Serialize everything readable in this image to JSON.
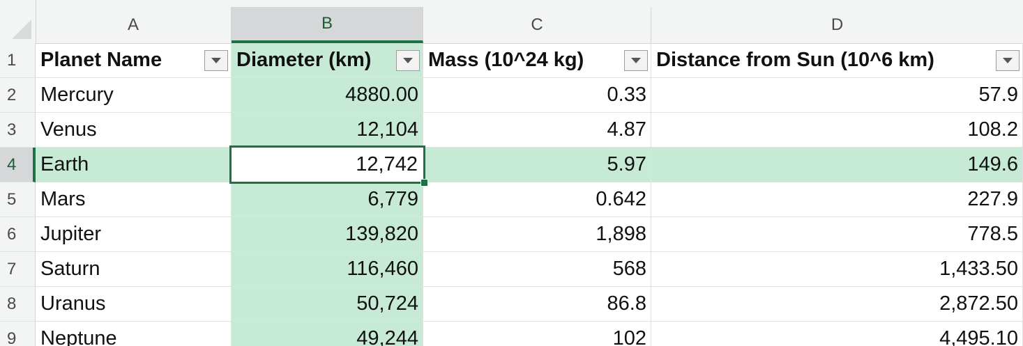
{
  "columns": [
    {
      "letter": "A"
    },
    {
      "letter": "B",
      "selected": true
    },
    {
      "letter": "C"
    },
    {
      "letter": "D"
    }
  ],
  "rows": [
    "1",
    "2",
    "3",
    "4",
    "5",
    "6",
    "7",
    "8",
    "9"
  ],
  "headers": {
    "planet": "Planet Name",
    "diameter": "Diameter (km)",
    "mass": "Mass (10^24 kg)",
    "distance": "Distance from Sun (10^6 km)"
  },
  "planets": [
    {
      "name": "Mercury",
      "diameter": "4880.00",
      "mass": "0.33",
      "distance": "57.9"
    },
    {
      "name": "Venus",
      "diameter": "12,104",
      "mass": "4.87",
      "distance": "108.2"
    },
    {
      "name": "Earth",
      "diameter": "12,742",
      "mass": "5.97",
      "distance": "149.6"
    },
    {
      "name": "Mars",
      "diameter": "6,779",
      "mass": "0.642",
      "distance": "227.9"
    },
    {
      "name": "Jupiter",
      "diameter": "139,820",
      "mass": "1,898",
      "distance": "778.5"
    },
    {
      "name": "Saturn",
      "diameter": "116,460",
      "mass": "568",
      "distance": "1,433.50"
    },
    {
      "name": "Uranus",
      "diameter": "50,724",
      "mass": "86.8",
      "distance": "2,872.50"
    },
    {
      "name": "Neptune",
      "diameter": "49,244",
      "mass": "102",
      "distance": "4,495.10"
    }
  ],
  "selection": {
    "active_cell": "B4",
    "selected_column": "B",
    "selected_row": "4"
  },
  "colors": {
    "accent": "#1e7145",
    "selection_fill": "#c6ead6",
    "header_bg": "#f3f4f4"
  },
  "icons": {
    "filter": "dropdown-arrow-icon",
    "select_all": "select-all-triangle-icon"
  }
}
